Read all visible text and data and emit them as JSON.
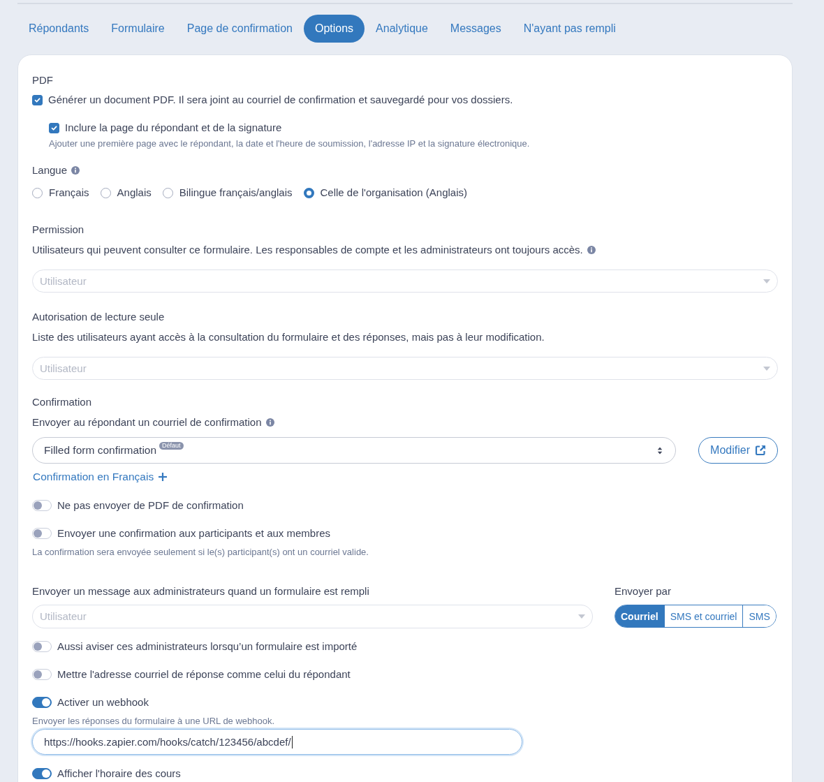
{
  "tabs": [
    {
      "label": "Répondants",
      "selected": false
    },
    {
      "label": "Formulaire",
      "selected": false
    },
    {
      "label": "Page de confirmation",
      "selected": false
    },
    {
      "label": "Options",
      "selected": true
    },
    {
      "label": "Analytique",
      "selected": false
    },
    {
      "label": "Messages",
      "selected": false
    },
    {
      "label": "N'ayant pas rempli",
      "selected": false
    }
  ],
  "pdf": {
    "title": "PDF",
    "checkbox": {
      "label": "Générer un document PDF. Il sera joint au courriel de confirmation et sauvegardé pour vos dossiers.",
      "checked": true,
      "children": [
        {
          "label": "Inclure la page du répondant et de la signature",
          "checked": true,
          "hint": "Ajouter une première page avec le répondant, la date et l'heure de soumission, l'adresse IP et la signature électronique."
        }
      ]
    }
  },
  "language": {
    "title": "Langue",
    "info_icon": true,
    "options": [
      {
        "label": "Français",
        "selected": false
      },
      {
        "label": "Anglais",
        "selected": false
      },
      {
        "label": "Bilingue français/anglais",
        "selected": false
      },
      {
        "label": "Celle de l'organisation (Anglais)",
        "selected": true
      }
    ]
  },
  "permission": {
    "title": "Permission",
    "description": "Utilisateurs qui peuvent consulter ce formulaire. Les responsables de compte et les administrateurs ont toujours accès.",
    "info_icon": true,
    "select": {
      "placeholder": "Utilisateur"
    }
  },
  "read_only": {
    "title": "Autorisation de lecture seule",
    "description": "Liste des utilisateurs ayant accès à la consultation du formulaire et des réponses, mais pas à leur modification.",
    "select": {
      "placeholder": "Utilisateur"
    }
  },
  "confirmation": {
    "title": "Confirmation",
    "label": "Envoyer au répondant un courriel de confirmation",
    "info_icon": true,
    "select": {
      "value": "Filled form confirmation",
      "badge": "Défaut"
    },
    "edit_button": "Modifier",
    "add_link": "Confirmation en Français",
    "toggles": [
      {
        "label": "Ne pas envoyer de PDF de confirmation",
        "on": false
      },
      {
        "label": "Envoyer une confirmation aux participants et aux membres",
        "on": false,
        "hint": "La confirmation sera envoyée seulement si le(s) participant(s) ont un courriel valide."
      }
    ]
  },
  "admin_notify": {
    "label": "Envoyer un message aux administrateurs quand un formulaire est rempli",
    "select": {
      "placeholder": "Utilisateur"
    },
    "send_by": {
      "label": "Envoyer par",
      "options": [
        {
          "label": "Courriel",
          "selected": true
        },
        {
          "label": "SMS et courriel",
          "selected": false
        },
        {
          "label": "SMS",
          "selected": false
        }
      ]
    }
  },
  "toggles": [
    {
      "label": "Aussi aviser ces administrateurs lorsqu’un formulaire est importé",
      "on": false
    },
    {
      "label": "Mettre l'adresse courriel de réponse comme celui du répondant",
      "on": false
    },
    {
      "label": "Activer un webhook",
      "on": true,
      "hint": "Envoyer les réponses du formulaire à une URL de webhook.",
      "input": {
        "value": "https://hooks.zapier.com/hooks/catch/123456/abcdef/",
        "focused": true
      }
    },
    {
      "label": "Afficher l'horaire des cours",
      "on": true
    }
  ]
}
